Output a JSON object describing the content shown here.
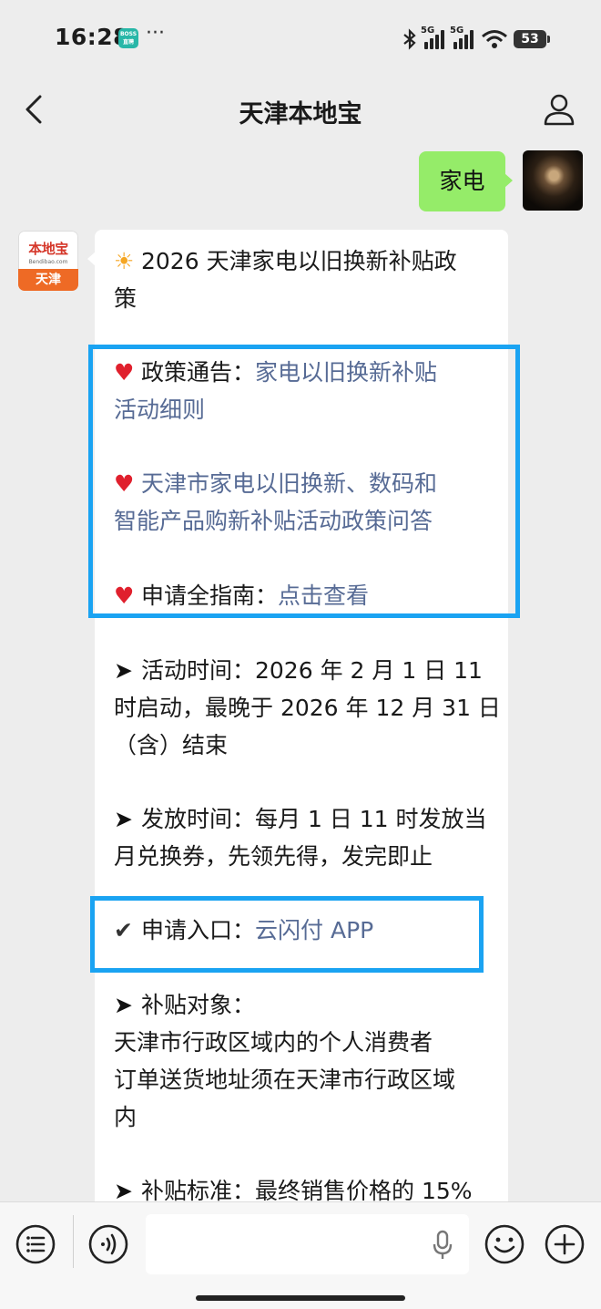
{
  "status_bar": {
    "time": "16:28",
    "app_badge": "BOSS直聘",
    "more": "···",
    "network_1": "5G",
    "network_2": "5G",
    "battery": "53"
  },
  "nav": {
    "title": "天津本地宝",
    "back_icon": "chevron-left-icon",
    "profile_icon": "person-icon"
  },
  "chat": {
    "my_message": "家电",
    "bot_avatar": {
      "logo_text": "本地宝",
      "url_text": "Bendibao.com",
      "city": "天津"
    },
    "reply": {
      "intro_line_1": "2026 天津家电以旧换新补贴政",
      "intro_line_2": "策",
      "notice_label": "政策通告：",
      "notice_link_1": "家电以旧换新补贴",
      "notice_link_2": "活动细则",
      "faq_link_1": "天津市家电以旧换新、数码和",
      "faq_link_2": "智能产品购新补贴活动政策问答",
      "guide_label": "申请全指南：",
      "guide_link": "点击查看",
      "time_line_1": "活动时间：2026 年 2 月 1 日 11",
      "time_line_2": "时启动，最晚于 2026 年 12 月 31 日",
      "time_line_3": "（含）结束",
      "issue_line_1": "发放时间：每月 1 日 11 时发放当",
      "issue_line_2": "月兑换券，先领先得，发完即止",
      "entry_label": "申请入口：",
      "entry_link": "云闪付 APP",
      "target_line_1": "补贴对象：",
      "target_line_2": "天津市行政区域内的个人消费者",
      "target_line_3": "订单送货地址须在天津市行政区域",
      "target_line_4": "内",
      "standard_line": "补贴标准：最终销售价格的 15%"
    }
  },
  "bottom_bar": {
    "menu_icon": "list-menu-icon",
    "voice_icon": "voice-mode-icon",
    "mic_icon": "microphone-icon",
    "emoji_icon": "smiley-icon",
    "plus_icon": "plus-icon"
  },
  "colors": {
    "background": "#ededed",
    "my_bubble": "#95ec69",
    "link": "#576b95",
    "highlight_box": "#1aa3f2",
    "heart": "#e0202d"
  }
}
